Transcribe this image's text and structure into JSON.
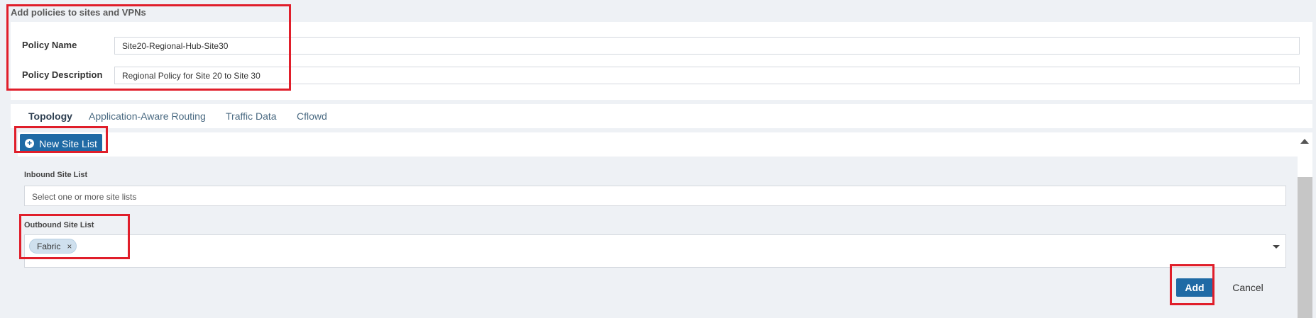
{
  "page": {
    "title": "Add policies to sites and VPNs"
  },
  "form": {
    "policy_name_label": "Policy Name",
    "policy_name_value": "Site20-Regional-Hub-Site30",
    "policy_description_label": "Policy Description",
    "policy_description_value": "Regional Policy for Site 20 to Site 30"
  },
  "tabs": [
    {
      "label": "Topology",
      "active": true
    },
    {
      "label": "Application-Aware Routing",
      "active": false
    },
    {
      "label": "Traffic Data",
      "active": false
    },
    {
      "label": "Cflowd",
      "active": false
    }
  ],
  "toolbar": {
    "new_site_list_label": "New Site List",
    "new_site_list_icon": "plus-circle-icon"
  },
  "site_lists": {
    "inbound_label": "Inbound Site List",
    "inbound_placeholder": "Select one or more site lists",
    "outbound_label": "Outbound Site List",
    "outbound_selected": [
      {
        "label": "Fabric",
        "remove_icon": "×"
      }
    ]
  },
  "actions": {
    "add_label": "Add",
    "cancel_label": "Cancel"
  },
  "colors": {
    "primary_button": "#1f6aa5",
    "highlight_box": "#e01e2a",
    "chip_background": "#cfe0ee"
  }
}
